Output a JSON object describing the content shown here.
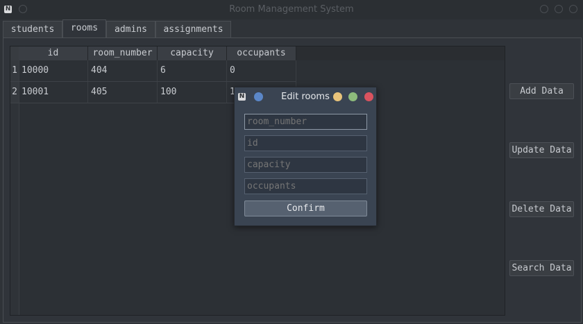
{
  "window": {
    "title": "Room Management System"
  },
  "tabs": [
    {
      "label": "students"
    },
    {
      "label": "rooms"
    },
    {
      "label": "admins"
    },
    {
      "label": "assignments"
    }
  ],
  "table": {
    "columns": [
      "id",
      "room_number",
      "capacity",
      "occupants"
    ],
    "row_numbers": [
      "1",
      "2"
    ],
    "rows": [
      [
        "10000",
        "404",
        "6",
        "0"
      ],
      [
        "10001",
        "405",
        "100",
        "1"
      ]
    ]
  },
  "side_buttons": {
    "add": "Add Data",
    "update": "Update Data",
    "delete": "Delete Data",
    "search": "Search Data"
  },
  "dialog": {
    "title": "Edit rooms",
    "fields": [
      {
        "placeholder": "room_number"
      },
      {
        "placeholder": "id"
      },
      {
        "placeholder": "capacity"
      },
      {
        "placeholder": "occupants"
      }
    ],
    "confirm": "Confirm",
    "colors": {
      "dot_left": "#5b87c8",
      "dot_yellow": "#e8c37a",
      "dot_green": "#8dbb7c",
      "dot_red": "#d9535f"
    }
  }
}
